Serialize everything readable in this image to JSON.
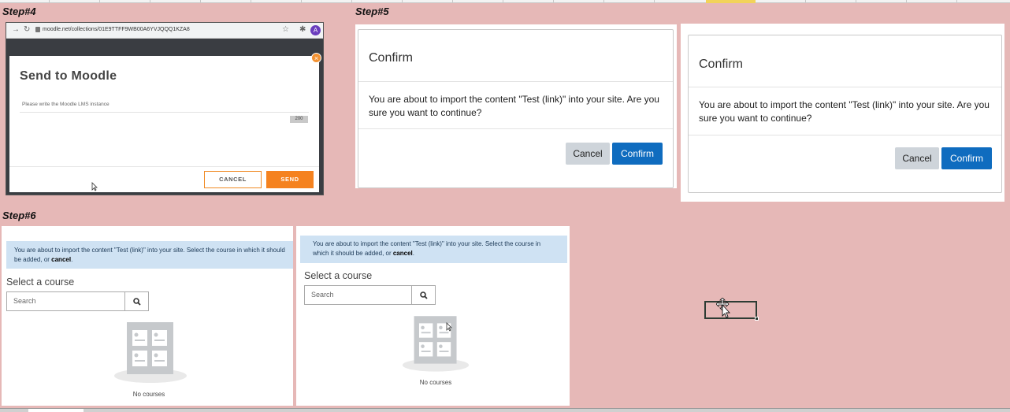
{
  "spreadsheet": {
    "step4_label": "Step#4",
    "step5_label": "Step#5",
    "step6_label": "Step#6"
  },
  "step4": {
    "url": "moodle.net/collections/01E9TTFF9WB00A6YVJQQQ1KZA8",
    "avatar_letter": "A",
    "modal_title": "Send to Moodle",
    "input_placeholder": "Please write the Moodle LMS instance",
    "char_counter": "200",
    "cancel_label": "CANCEL",
    "send_label": "SEND",
    "close_glyph": "×"
  },
  "confirm_dialogs": [
    {
      "title": "Confirm",
      "body": "You are about to import the content \"Test (link)\" into your site. Are you sure you want to continue?",
      "cancel_label": "Cancel",
      "confirm_label": "Confirm"
    },
    {
      "title": "Confirm",
      "body": "You are about to import the content \"Test (link)\" into your site. Are you sure you want to continue?",
      "cancel_label": "Cancel",
      "confirm_label": "Confirm"
    }
  ],
  "select_course_panels": [
    {
      "alert_text": "You are about to import the content \"Test (link)\" into your site. Select the course in which it should be added, or ",
      "alert_link": "cancel",
      "alert_end": ".",
      "heading": "Select a course",
      "search_placeholder": "Search",
      "empty_text": "No courses"
    },
    {
      "alert_text": "You are about to import the content \"Test (link)\" into your site. Select the course in which it should be added, or ",
      "alert_link": "cancel",
      "alert_end": ".",
      "heading": "Select a course",
      "search_placeholder": "Search",
      "empty_text": "No courses"
    }
  ],
  "colors": {
    "sheet_background": "#e6b8b7",
    "moodle_orange": "#f5821f",
    "moodle_blue": "#0f6cbf",
    "alert_blue": "#cfe2f3"
  }
}
